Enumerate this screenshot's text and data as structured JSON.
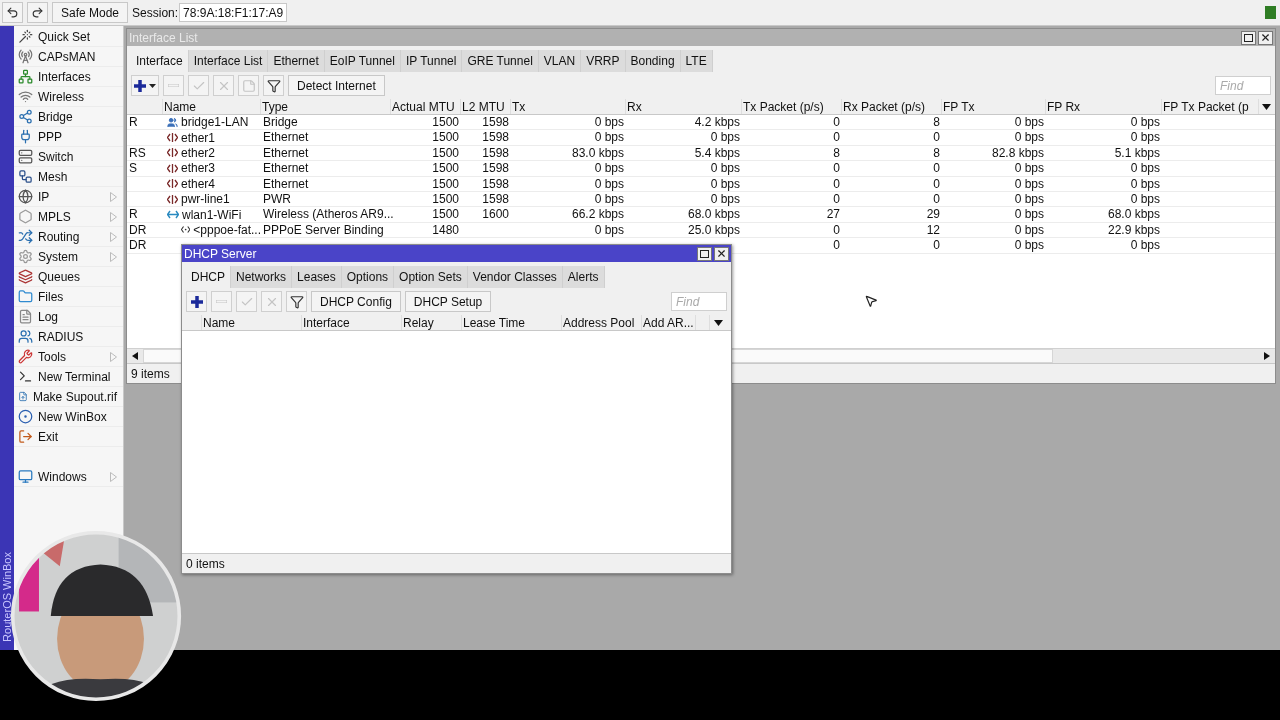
{
  "toolbar": {
    "safe_mode": "Safe Mode",
    "session_label": "Session:",
    "session_value": "78:9A:18:F1:17:A9",
    "connected": true
  },
  "sidebar": {
    "brand": "RouterOS WinBox",
    "items": [
      {
        "label": "Quick Set",
        "submenu": false
      },
      {
        "label": "CAPsMAN",
        "submenu": false
      },
      {
        "label": "Interfaces",
        "submenu": false
      },
      {
        "label": "Wireless",
        "submenu": false
      },
      {
        "label": "Bridge",
        "submenu": false
      },
      {
        "label": "PPP",
        "submenu": false
      },
      {
        "label": "Switch",
        "submenu": false
      },
      {
        "label": "Mesh",
        "submenu": false
      },
      {
        "label": "IP",
        "submenu": true
      },
      {
        "label": "MPLS",
        "submenu": true
      },
      {
        "label": "Routing",
        "submenu": true
      },
      {
        "label": "System",
        "submenu": true
      },
      {
        "label": "Queues",
        "submenu": false
      },
      {
        "label": "Files",
        "submenu": false
      },
      {
        "label": "Log",
        "submenu": false
      },
      {
        "label": "RADIUS",
        "submenu": false
      },
      {
        "label": "Tools",
        "submenu": true
      },
      {
        "label": "New Terminal",
        "submenu": false
      },
      {
        "label": "Make Supout.rif",
        "submenu": false
      },
      {
        "label": "New WinBox",
        "submenu": false
      },
      {
        "label": "Exit",
        "submenu": false
      }
    ],
    "bottom_items": [
      {
        "label": "Windows",
        "submenu": true
      }
    ]
  },
  "interface_window": {
    "title": "Interface List",
    "active": false,
    "tabs": [
      {
        "label": "Interface",
        "selected": true
      },
      {
        "label": "Interface List",
        "selected": false
      },
      {
        "label": "Ethernet",
        "selected": false
      },
      {
        "label": "EoIP Tunnel",
        "selected": false
      },
      {
        "label": "IP Tunnel",
        "selected": false
      },
      {
        "label": "GRE Tunnel",
        "selected": false
      },
      {
        "label": "VLAN",
        "selected": false
      },
      {
        "label": "VRRP",
        "selected": false
      },
      {
        "label": "Bonding",
        "selected": false
      },
      {
        "label": "LTE",
        "selected": false
      }
    ],
    "tools": [
      {
        "kind": "add-menu",
        "disabled": false
      },
      {
        "kind": "remove",
        "disabled": true
      },
      {
        "kind": "enable",
        "disabled": true
      },
      {
        "kind": "disable",
        "disabled": true
      },
      {
        "kind": "comment",
        "disabled": true
      },
      {
        "kind": "filter",
        "disabled": false
      }
    ],
    "buttons": [
      "Detect Internet"
    ],
    "find": {
      "placeholder": "Find"
    },
    "columns": [
      "Name",
      "Type",
      "Actual MTU",
      "L2 MTU",
      "Tx",
      "Rx",
      "Tx Packet (p/s)",
      "Rx Packet (p/s)",
      "FP Tx",
      "FP Rx",
      "FP Tx Packet (p"
    ],
    "rows": [
      {
        "flags": "R",
        "kind": "bridge",
        "cells": [
          "bridge1-LAN",
          "Bridge",
          "1500",
          "1598",
          "0 bps",
          "4.2 kbps",
          "0",
          "8",
          "0 bps",
          "0 bps"
        ]
      },
      {
        "kind": "ethernet",
        "cells": [
          "ether1",
          "Ethernet",
          "1500",
          "1598",
          "0 bps",
          "0 bps",
          "0",
          "0",
          "0 bps",
          "0 bps"
        ]
      },
      {
        "flags": "RS",
        "kind": "ethernet",
        "cells": [
          "ether2",
          "Ethernet",
          "1500",
          "1598",
          "83.0 kbps",
          "5.4 kbps",
          "8",
          "8",
          "82.8 kbps",
          "5.1 kbps"
        ]
      },
      {
        "flags": "S",
        "kind": "ethernet",
        "cells": [
          "ether3",
          "Ethernet",
          "1500",
          "1598",
          "0 bps",
          "0 bps",
          "0",
          "0",
          "0 bps",
          "0 bps"
        ]
      },
      {
        "kind": "ethernet",
        "cells": [
          "ether4",
          "Ethernet",
          "1500",
          "1598",
          "0 bps",
          "0 bps",
          "0",
          "0",
          "0 bps",
          "0 bps"
        ]
      },
      {
        "kind": "ethernet",
        "cells": [
          "pwr-line1",
          "PWR",
          "1500",
          "1598",
          "0 bps",
          "0 bps",
          "0",
          "0",
          "0 bps",
          "0 bps"
        ]
      },
      {
        "flags": "R",
        "kind": "wireless",
        "cells": [
          "wlan1-WiFi",
          "Wireless (Atheros AR9...",
          "1500",
          "1600",
          "66.2 kbps",
          "68.0 kbps",
          "27",
          "29",
          "0 bps",
          "68.0 kbps"
        ]
      },
      {
        "flags": "DR",
        "kind": "binding",
        "cells": [
          "<pppoe-fat...",
          "PPPoE Server Binding",
          "1480",
          null,
          "0 bps",
          "25.0 kbps",
          "0",
          "12",
          "0 bps",
          "22.9 kbps"
        ]
      },
      {
        "flags": "DR",
        "cells": [
          null,
          null,
          null,
          null,
          null,
          null,
          "0",
          "0",
          "0 bps",
          "0 bps"
        ]
      }
    ],
    "status": "9 items"
  },
  "dhcp_window": {
    "title": "DHCP Server",
    "active": true,
    "tabs": [
      {
        "label": "DHCP",
        "selected": true
      },
      {
        "label": "Networks",
        "selected": false
      },
      {
        "label": "Leases",
        "selected": false
      },
      {
        "label": "Options",
        "selected": false
      },
      {
        "label": "Option Sets",
        "selected": false
      },
      {
        "label": "Vendor Classes",
        "selected": false
      },
      {
        "label": "Alerts",
        "selected": false
      }
    ],
    "tools": [
      {
        "kind": "add",
        "disabled": false
      },
      {
        "kind": "remove",
        "disabled": true
      },
      {
        "kind": "enable",
        "disabled": true
      },
      {
        "kind": "disable",
        "disabled": true
      },
      {
        "kind": "filter",
        "disabled": false
      }
    ],
    "buttons": [
      "DHCP Config",
      "DHCP Setup"
    ],
    "find": {
      "placeholder": "Find"
    },
    "columns": [
      "Name",
      "Interface",
      "Relay",
      "Lease Time",
      "Address Pool",
      "Add AR..."
    ],
    "status": "0 items"
  }
}
